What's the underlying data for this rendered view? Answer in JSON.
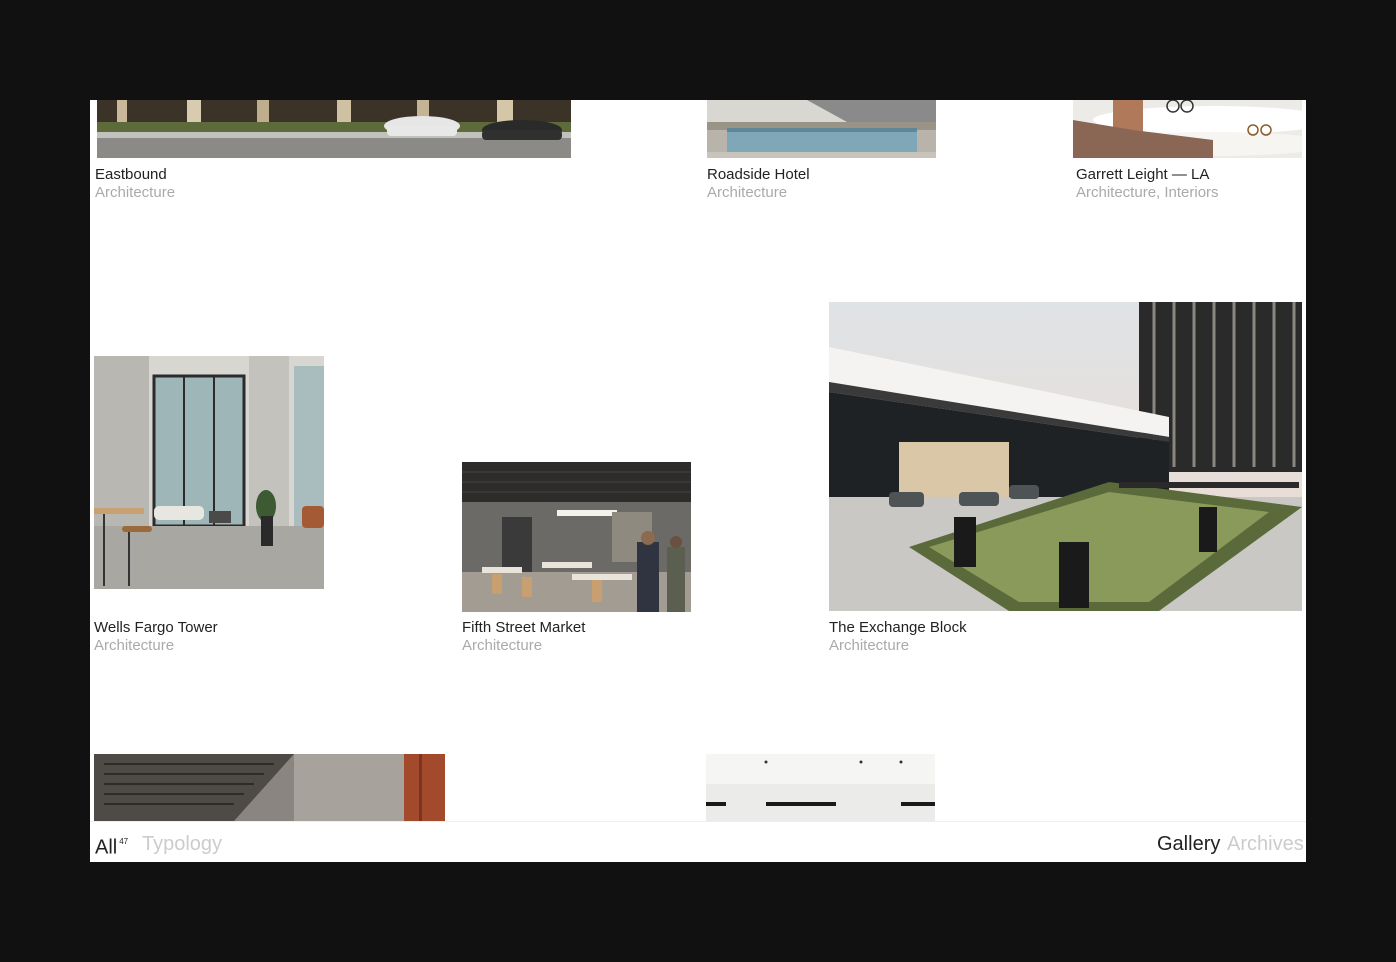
{
  "projects": [
    {
      "title": "Eastbound",
      "category": "Architecture"
    },
    {
      "title": "Roadside Hotel",
      "category": "Architecture"
    },
    {
      "title": "Garrett Leight — LA",
      "category": "Architecture, Interiors"
    },
    {
      "title": "Wells Fargo Tower",
      "category": "Architecture"
    },
    {
      "title": "Fifth Street Market",
      "category": "Architecture"
    },
    {
      "title": "The Exchange Block",
      "category": "Architecture"
    }
  ],
  "footer": {
    "all_label": "All",
    "all_count": "47",
    "typology_label": "Typology",
    "gallery_label": "Gallery",
    "archives_label": "Archives"
  },
  "colors": {
    "background": "#111111",
    "page": "#ffffff",
    "text": "#222222",
    "muted": "#aaaaaa",
    "inactive": "#cccccc"
  }
}
